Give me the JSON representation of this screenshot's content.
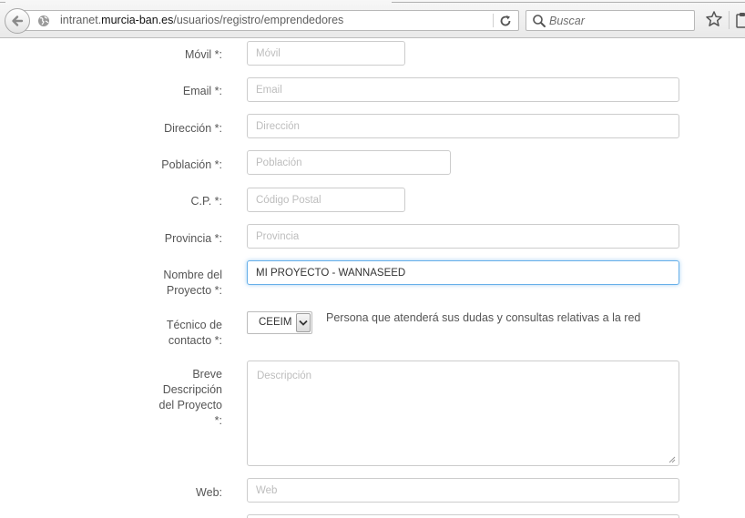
{
  "browser": {
    "url_prefix": "intranet.",
    "url_domain": "murcia-ban.es",
    "url_path": "/usuarios/registro/emprendedores",
    "search_placeholder": "Buscar",
    "icons": [
      "back-arrow-icon",
      "globe-icon",
      "reload-icon",
      "search-icon",
      "star-icon",
      "clipboard-icon"
    ]
  },
  "form": {
    "movil": {
      "label": "Móvil *:",
      "placeholder": "Móvil",
      "value": ""
    },
    "email": {
      "label": "Email *:",
      "placeholder": "Email",
      "value": ""
    },
    "direccion": {
      "label": "Dirección *:",
      "placeholder": "Dirección",
      "value": ""
    },
    "poblacion": {
      "label": "Población *:",
      "placeholder": "Población",
      "value": ""
    },
    "cp": {
      "label": "C.P. *:",
      "placeholder": "Código Postal",
      "value": ""
    },
    "provincia": {
      "label": "Provincia *:",
      "placeholder": "Provincia",
      "value": ""
    },
    "nombre_proyecto": {
      "label_line1": "Nombre del",
      "label_line2": "Proyecto *:",
      "value": "MI PROYECTO - WANNASEED"
    },
    "tecnico": {
      "label_line1": "Técnico de",
      "label_line2": "contacto *:",
      "selected": "CEEIM",
      "hint": "Persona que atenderá sus dudas y consultas relativas a la red"
    },
    "descripcion": {
      "label_line1": "Breve",
      "label_line2": "Descripción",
      "label_line3": "del Proyecto",
      "label_line4": "*:",
      "placeholder": "Descripción",
      "value": ""
    },
    "web": {
      "label": "Web:",
      "placeholder": "Web",
      "value": ""
    }
  },
  "colors": {
    "focus_border": "#66afe9",
    "input_border": "#cccccc",
    "label_text": "#555555"
  }
}
